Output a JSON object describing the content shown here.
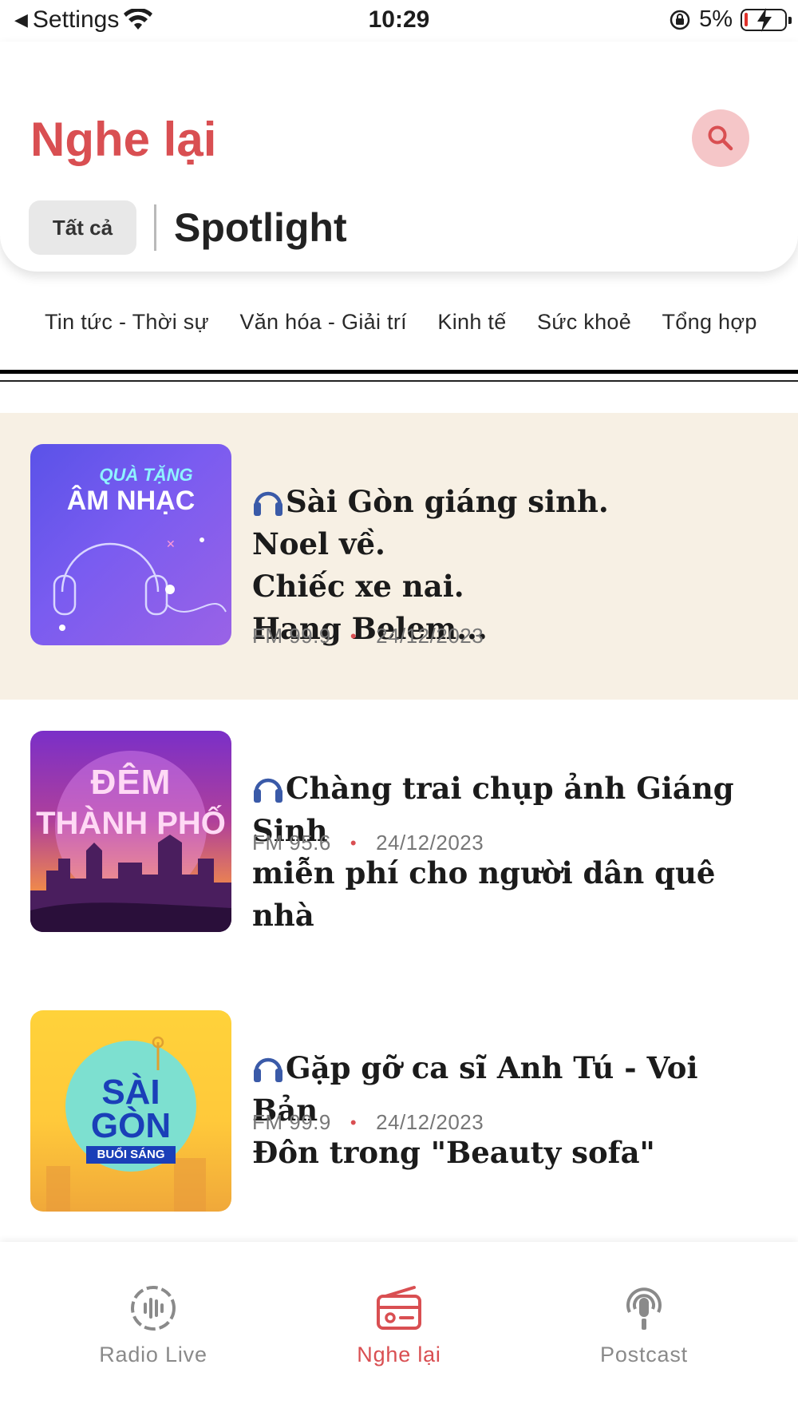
{
  "status_bar": {
    "back_label": "Settings",
    "time": "10:29",
    "battery": "5%"
  },
  "header": {
    "title": "Nghe lại",
    "filter_all": "Tất cả",
    "spotlight": "Spotlight"
  },
  "categories": [
    "Tin tức - Thời sự",
    "Văn hóa - Giải trí",
    "Kinh tế",
    "Sức khoẻ",
    "Tổng hợp"
  ],
  "items": [
    {
      "title": "Sài Gòn giáng sinh.\nNoel về.\nChiếc xe nai.\nHang Belem...",
      "station": "FM 99.9",
      "date": "24/12/2023",
      "thumb_line1": "QUÀ TẶNG",
      "thumb_line2": "ÂM NHẠC"
    },
    {
      "title": "Chàng trai chụp ảnh Giáng Sinh\nmiễn phí cho người dân quê nhà",
      "station": "FM 95.6",
      "date": "24/12/2023",
      "thumb_line1": "ĐÊM",
      "thumb_line2": "THÀNH PHỐ"
    },
    {
      "title": "Gặp gỡ ca sĩ Anh Tú - Voi Bản\nĐôn trong \"Beauty sofa\"",
      "station": "FM 99.9",
      "date": "24/12/2023",
      "thumb_line1": "SÀI",
      "thumb_line2": "GÒN",
      "thumb_line3": "BUỔI SÁNG"
    }
  ],
  "tabs": [
    {
      "label": "Radio Live",
      "icon": "radio-wave-icon"
    },
    {
      "label": "Nghe lại",
      "icon": "radio-icon"
    },
    {
      "label": "Postcast",
      "icon": "podcast-icon"
    }
  ],
  "colors": {
    "accent": "#d94f52",
    "highlight_bg": "#f7f0e4",
    "search_bg": "#f5c6c8"
  }
}
